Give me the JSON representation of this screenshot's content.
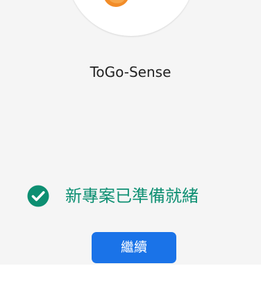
{
  "app": {
    "project_name": "ToGo-Sense"
  },
  "status": {
    "message": "新專案已準備就緒",
    "icon": "check-circle-icon",
    "color": "#0d8f72"
  },
  "actions": {
    "continue_label": "繼續",
    "button_color": "#1a73e8"
  },
  "logo": {
    "icon": "app-logo-icon",
    "accent_color": "#f28c28"
  }
}
